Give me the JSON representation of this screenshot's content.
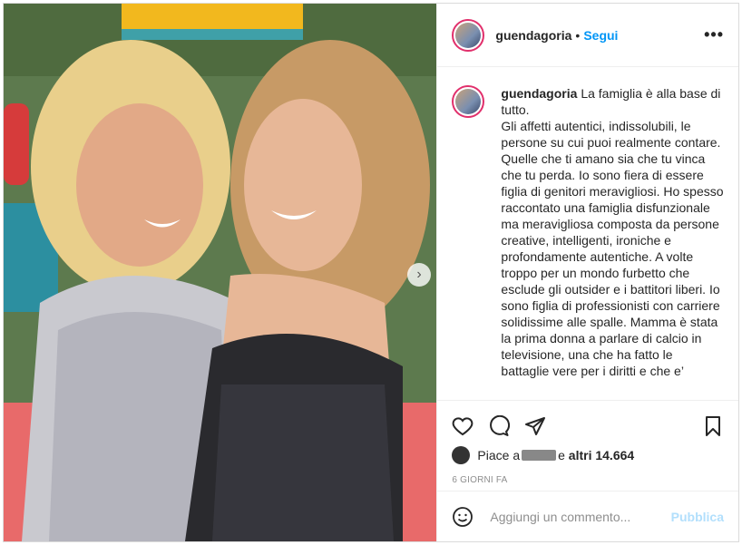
{
  "post": {
    "username": "guendagoria",
    "follow_label": "Segui",
    "separator": "•",
    "more_label": "•••"
  },
  "caption": {
    "username": "guendagoria",
    "text": "La famiglia è alla base di tutto.\nGli affetti autentici, indissolubili, le persone su cui puoi realmente contare. Quelle che ti amano sia che tu vinca che tu perda. Io sono fiera di essere figlia di genitori meravigliosi. Ho spesso raccontato una famiglia disfunzionale ma meravigliosa composta da persone creative, intelligenti, ironiche e profondamente autentiche. A volte troppo per un mondo furbetto che esclude gli outsider e i battitori liberi. Io sono figlia di professionisti con carriere solidissime alle spalle. Mamma è stata la prima donna a parlare di calcio in televisione, una che ha fatto le battaglie vere per i diritti e che e’"
  },
  "likes": {
    "prefix": "Piace a",
    "connector": "e",
    "others": "altri 14.664"
  },
  "timestamp": "6 giorni fa",
  "comment": {
    "placeholder": "Aggiungi un commento...",
    "publish_label": "Pubblica"
  },
  "colors": {
    "accent": "#0095f6",
    "publish_disabled": "#b2dffc",
    "text": "#262626",
    "muted": "#8e8e8e"
  },
  "icons": [
    "heart-icon",
    "comment-icon",
    "share-icon",
    "bookmark-icon",
    "emoji-icon",
    "chevron-right-icon"
  ]
}
